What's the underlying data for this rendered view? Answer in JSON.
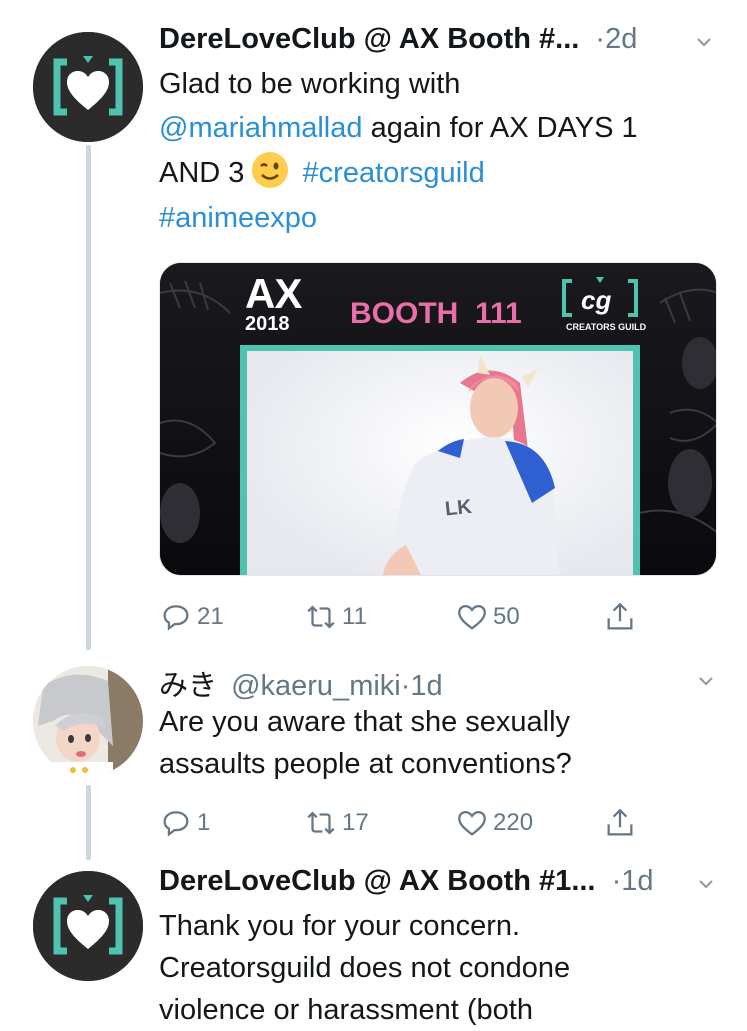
{
  "tweets": [
    {
      "author": "DereLoveClub @ AX Booth #...",
      "time": "·2d",
      "lines": [
        "Glad to be working with",
        "again for AX DAYS 1",
        "AND 3",
        "#creatorsguild",
        "#animeexpo"
      ],
      "mention": "@mariahmallad",
      "media": {
        "ax_logo": "AX",
        "ax_year": "2018",
        "booth": "BOOTH  111",
        "cg_logo": "cg",
        "cg_name": "CREATORS GUILD",
        "shirt_text": "LK"
      },
      "replies": "21",
      "retweets": "11",
      "likes": "50"
    },
    {
      "author": "みき",
      "handle": "@kaeru_miki",
      "time": "·1d",
      "lines": [
        "Are you aware that she sexually",
        "assaults people at conventions?"
      ],
      "replies": "1",
      "retweets": "17",
      "likes": "220"
    },
    {
      "author": "DereLoveClub @ AX Booth #1...",
      "time": "·1d",
      "lines": [
        "Thank you for your concern.",
        "Creatorsguild does not condone",
        "violence or harassment (both"
      ]
    }
  ],
  "icons": {
    "reply": "reply-icon",
    "retweet": "retweet-icon",
    "like": "heart-icon",
    "share": "share-icon",
    "caret": "chevron-down-icon",
    "emoji": "winking-face-emoji"
  },
  "colors": {
    "link": "#2a8fd6",
    "muted": "#657786",
    "thread": "#ccd6dd",
    "teal": "#4fc3b0",
    "pink": "#e86fa8"
  }
}
